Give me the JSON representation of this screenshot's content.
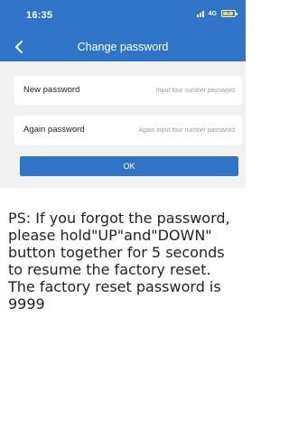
{
  "status_bar": {
    "time": "16:35",
    "network": "4G",
    "signal_icon": "signal-bars-icon",
    "battery_icon": "battery-charging-icon"
  },
  "header": {
    "title": "Change password",
    "back_icon": "chevron-left-icon",
    "background_color": "#2f74c8"
  },
  "form": {
    "new_password": {
      "label": "New password",
      "placeholder": "Input four number password",
      "value": ""
    },
    "again_password": {
      "label": "Again password",
      "placeholder": "Again input four number password",
      "value": ""
    },
    "ok_label": "OK"
  },
  "note": {
    "lines": [
      "PS: If you forgot the password,",
      "please hold\"UP\"and\"DOWN\"",
      "button together for 5 seconds",
      "to resume the factory reset.",
      "The factory reset password is",
      "9999"
    ]
  },
  "colors": {
    "accent": "#2f74c8",
    "form_background": "#f2f2f2",
    "placeholder": "#9a9a9a"
  }
}
